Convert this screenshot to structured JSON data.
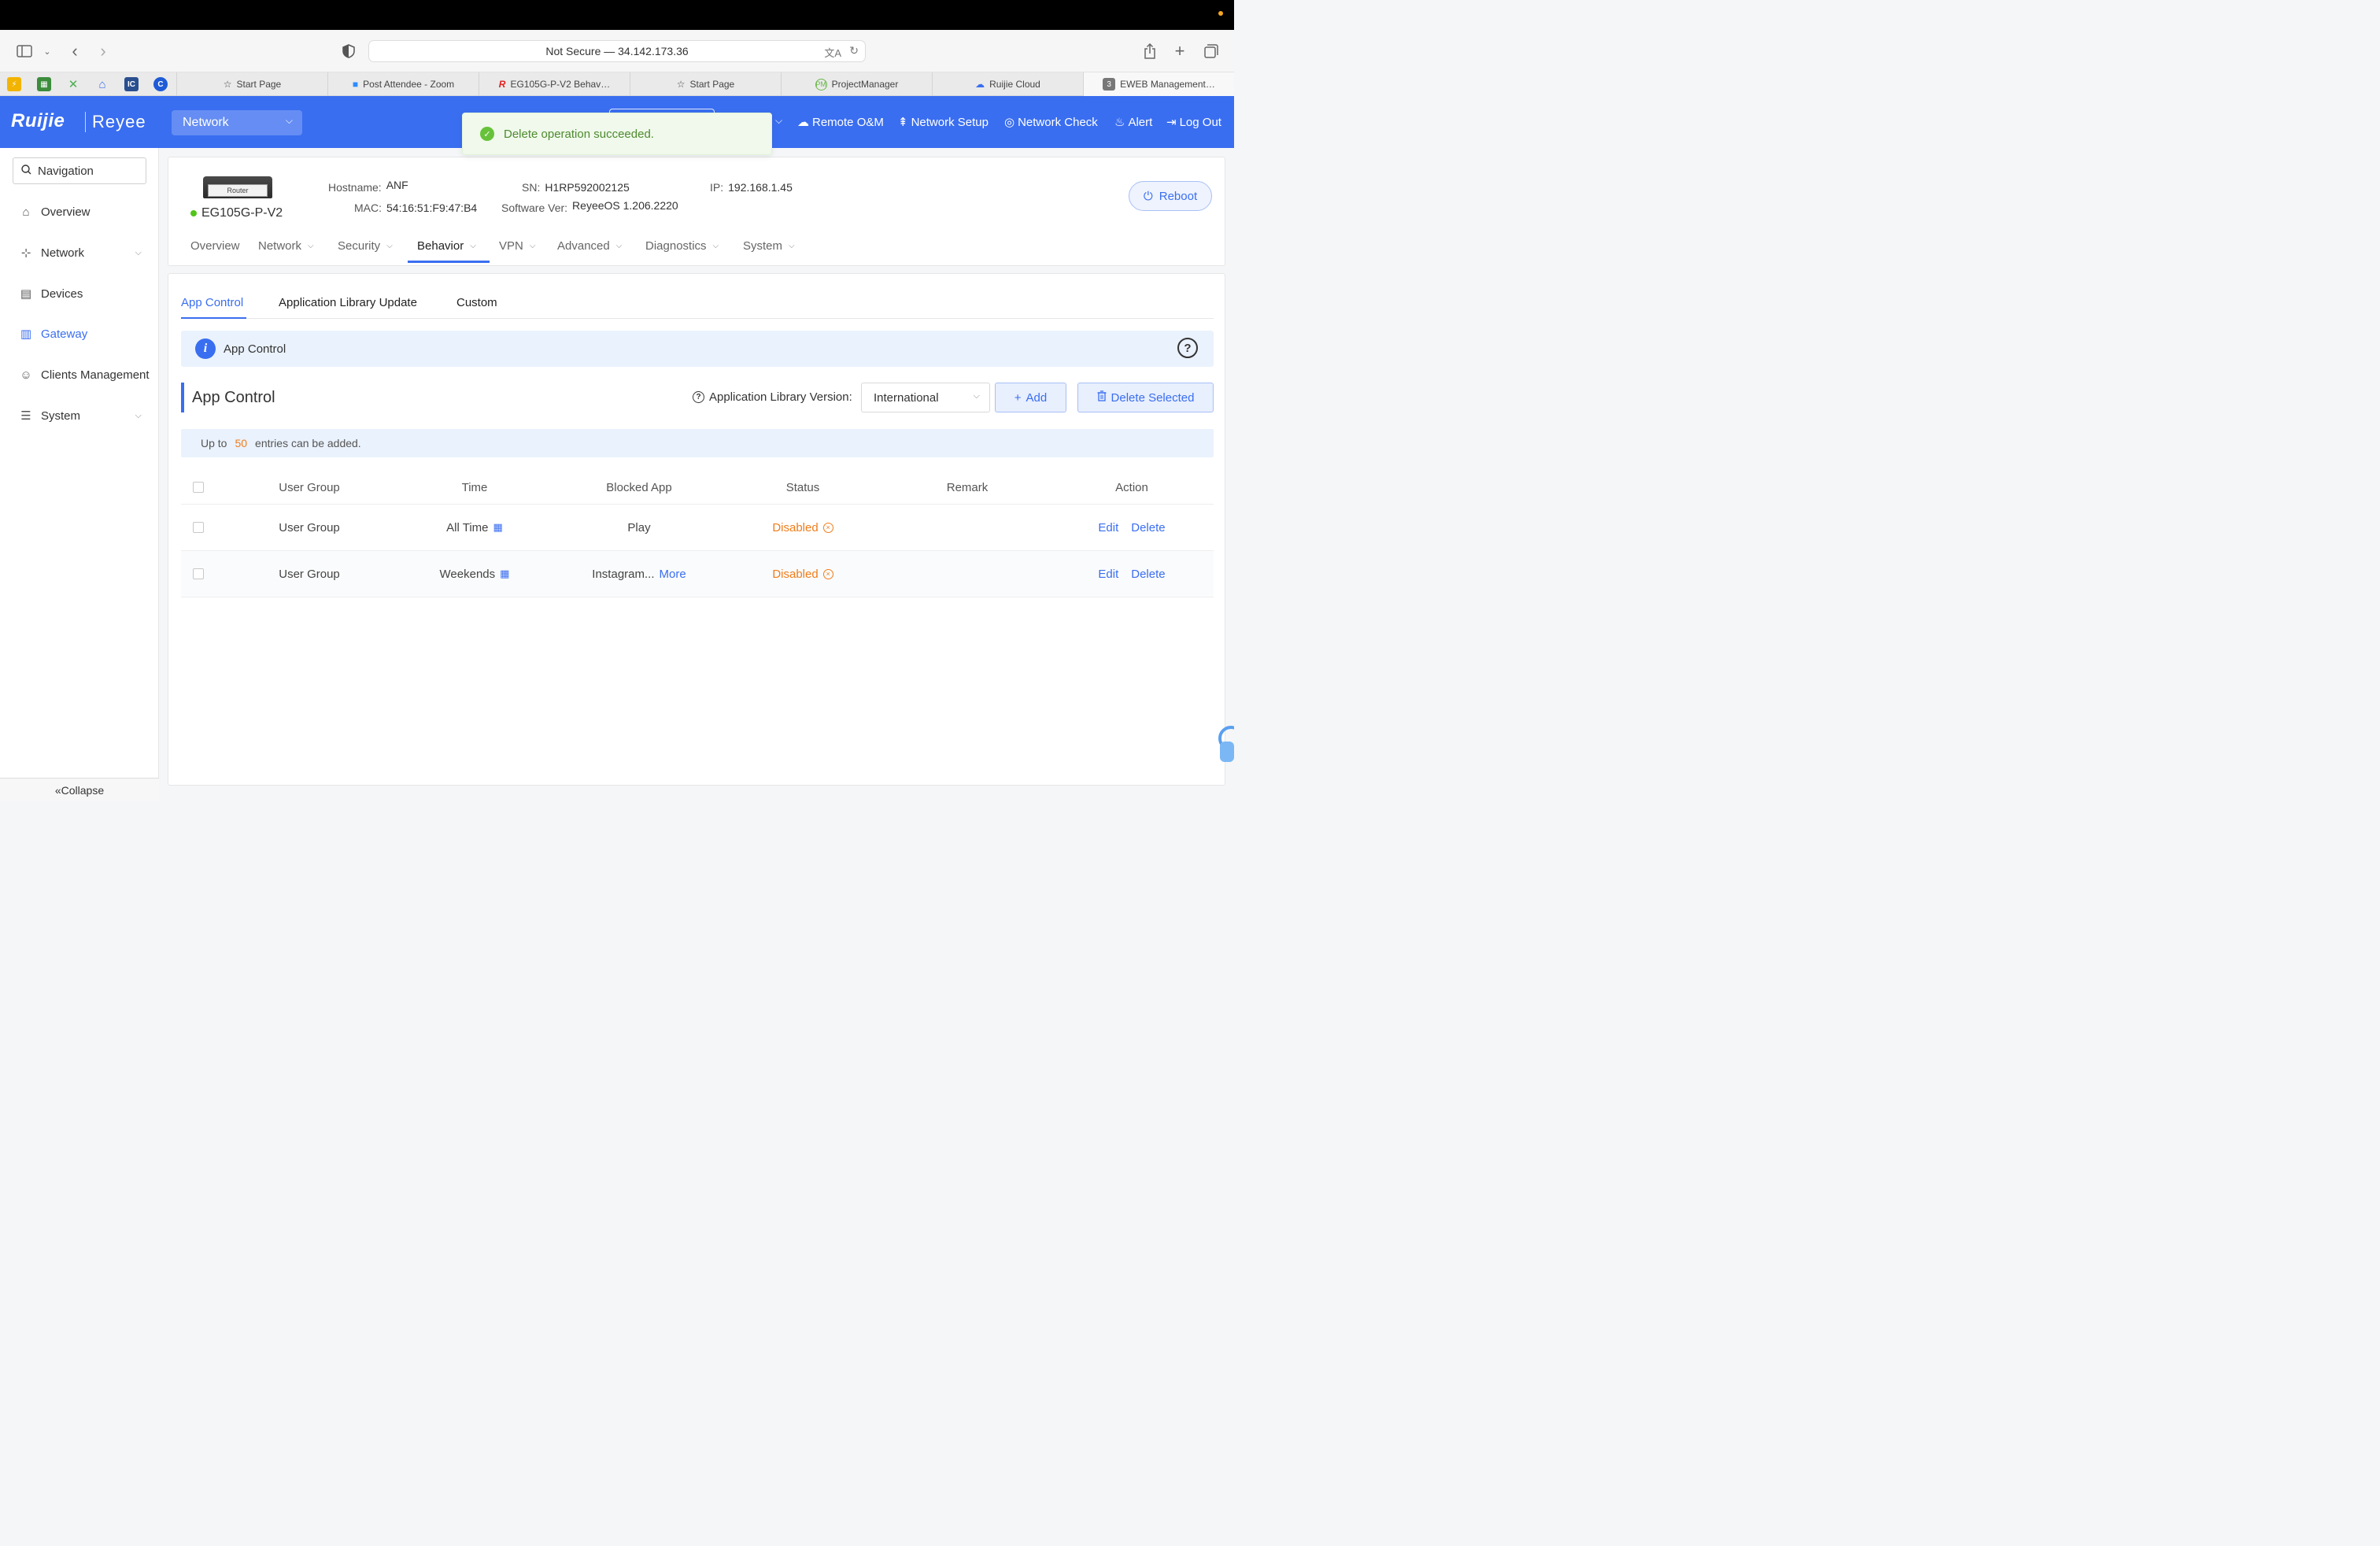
{
  "browser": {
    "url": "Not Secure — 34.142.173.36",
    "tabs": [
      {
        "label": "Start Page",
        "icon": "star-icon"
      },
      {
        "label": "Post Attendee - Zoom",
        "icon": "zoom-icon"
      },
      {
        "label": "EG105G-P-V2 Behav…",
        "icon": "ruijie-icon"
      },
      {
        "label": "Start Page",
        "icon": "star-icon"
      },
      {
        "label": "ProjectManager",
        "icon": "pm-icon"
      },
      {
        "label": "Ruijie Cloud",
        "icon": "cloud-icon"
      },
      {
        "label": "EWEB Management…",
        "icon": "group-count-icon",
        "badge": "3"
      }
    ]
  },
  "header": {
    "logo": "Ruijie",
    "logo2": "Reyee",
    "network_select": "Network",
    "nav": {
      "remote": "Remote O&M",
      "setup": "Network Setup",
      "check": "Network Check",
      "alert": "Alert",
      "logout": "Log Out"
    }
  },
  "toast": {
    "message": "Delete operation succeeded."
  },
  "sidebar": {
    "search_placeholder": "Navigation",
    "items": [
      {
        "label": "Overview"
      },
      {
        "label": "Network"
      },
      {
        "label": "Devices"
      },
      {
        "label": "Gateway"
      },
      {
        "label": "Clients Management"
      },
      {
        "label": "System"
      }
    ],
    "collapse": "Collapse"
  },
  "device": {
    "image_label": "Router",
    "name": "EG105G-P-V2",
    "hostname_label": "Hostname:",
    "hostname": "ANF",
    "sn_label": "SN:",
    "sn": "H1RP592002125",
    "ip_label": "IP:",
    "ip": "192.168.1.45",
    "mac_label": "MAC:",
    "mac": "54:16:51:F9:47:B4",
    "sw_label": "Software Ver:",
    "sw": "ReyeeOS 1.206.2220",
    "reboot": "Reboot",
    "tabs": [
      "Overview",
      "Network",
      "Security",
      "Behavior",
      "VPN",
      "Advanced",
      "Diagnostics",
      "System"
    ]
  },
  "content": {
    "subtabs": [
      "App Control",
      "Application Library Update",
      "Custom"
    ],
    "info_title": "App Control",
    "section_title": "App Control",
    "lib_label": "Application Library Version:",
    "lib_value": "International",
    "add": "Add",
    "delete_selected": "Delete Selected",
    "limit_prefix": "Up to",
    "limit_count": "50",
    "limit_suffix": "entries can be added.",
    "columns": [
      "User Group",
      "Time",
      "Blocked App",
      "Status",
      "Remark",
      "Action"
    ],
    "rows": [
      {
        "group": "User Group",
        "time": "All Time",
        "app": "Play",
        "more": "",
        "status": "Disabled",
        "remark": "",
        "edit": "Edit",
        "delete": "Delete"
      },
      {
        "group": "User Group",
        "time": "Weekends",
        "app": "Instagram...",
        "more": "More",
        "status": "Disabled",
        "remark": "",
        "edit": "Edit",
        "delete": "Delete"
      }
    ]
  },
  "colors": {
    "primary": "#3a6ef0",
    "warning": "#f07d1a",
    "success": "#67c23a"
  }
}
